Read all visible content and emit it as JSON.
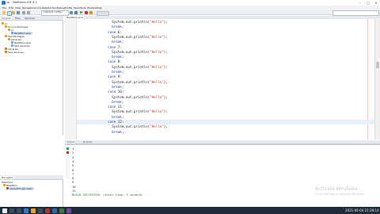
{
  "window": {
    "title": "pr - NetBeans IDE 8.2",
    "controls": [
      "–",
      "□",
      "✕"
    ]
  },
  "menubar": {
    "items": [
      "File",
      "Edit",
      "View",
      "Navigate",
      "Source",
      "Refactor",
      "Run",
      "Debug",
      "Profile",
      "Team",
      "Tools",
      "Window",
      "Help"
    ]
  },
  "toolbar": {
    "config_select": "<default config>"
  },
  "projects_panel": {
    "tabs": [
      "Projects",
      "Files",
      "Services"
    ],
    "tree": [
      {
        "label": "pr",
        "level": 0
      },
      {
        "label": "Source Packages",
        "level": 1
      },
      {
        "label": "pr",
        "level": 2
      },
      {
        "label": "NewMain.java",
        "level": 3
      },
      {
        "label": "Test Packages",
        "level": 1
      },
      {
        "label": "Libraries",
        "level": 1
      },
      {
        "label": "NewMain.java",
        "level": 3
      },
      {
        "label": "Test Libraries",
        "level": 1
      },
      {
        "label": "Libraries",
        "level": 0
      },
      {
        "label": "Test Libraries",
        "level": 0
      }
    ]
  },
  "navigator_panel": {
    "tabs": [
      "Navigator"
    ],
    "items": [
      "Members",
      "NewMain",
      "main(String[] args)"
    ]
  },
  "editor": {
    "tab_label": "NewMain.java",
    "toolbar_buttons": [
      "Source",
      "History"
    ],
    "code_lines": [
      {
        "indent": 10,
        "parts": [
          {
            "t": "System.out.println("
          },
          {
            "t": "\"Hello\"",
            "c": "str"
          },
          {
            "t": ");"
          }
        ]
      },
      {
        "indent": 10,
        "parts": [
          {
            "t": "break",
            "c": "kw"
          },
          {
            "t": ";"
          }
        ]
      },
      {
        "indent": 8,
        "parts": [
          {
            "t": "case",
            "c": "kw"
          },
          {
            "t": " 6:"
          }
        ]
      },
      {
        "indent": 10,
        "parts": [
          {
            "t": "System.out.println("
          },
          {
            "t": "\"Hello\"",
            "c": "str"
          },
          {
            "t": ");"
          }
        ]
      },
      {
        "indent": 10,
        "parts": [
          {
            "t": "break",
            "c": "kw"
          },
          {
            "t": ";"
          }
        ]
      },
      {
        "indent": 8,
        "parts": [
          {
            "t": "case",
            "c": "kw"
          },
          {
            "t": " 7:"
          }
        ]
      },
      {
        "indent": 10,
        "parts": [
          {
            "t": "System.out.println("
          },
          {
            "t": "\"Hello\"",
            "c": "str"
          },
          {
            "t": ");"
          }
        ]
      },
      {
        "indent": 10,
        "parts": [
          {
            "t": "break",
            "c": "kw"
          },
          {
            "t": ";"
          }
        ]
      },
      {
        "indent": 8,
        "parts": [
          {
            "t": "case",
            "c": "kw"
          },
          {
            "t": " 8:"
          }
        ]
      },
      {
        "indent": 10,
        "parts": [
          {
            "t": "System.out.println("
          },
          {
            "t": "\"Hello\"",
            "c": "str"
          },
          {
            "t": ");"
          }
        ]
      },
      {
        "indent": 10,
        "parts": [
          {
            "t": "break",
            "c": "kw"
          },
          {
            "t": ";"
          }
        ]
      },
      {
        "indent": 8,
        "parts": [
          {
            "t": "case",
            "c": "kw"
          },
          {
            "t": " 9:"
          }
        ]
      },
      {
        "indent": 10,
        "parts": [
          {
            "t": "System.out.println("
          },
          {
            "t": "\"Hello\"",
            "c": "str"
          },
          {
            "t": ");"
          }
        ]
      },
      {
        "indent": 10,
        "parts": [
          {
            "t": "break",
            "c": "kw"
          },
          {
            "t": ";"
          }
        ]
      },
      {
        "indent": 8,
        "parts": [
          {
            "t": "case",
            "c": "kw"
          },
          {
            "t": " 10:"
          }
        ]
      },
      {
        "indent": 10,
        "parts": [
          {
            "t": "System.out.println("
          },
          {
            "t": "\"Hello\"",
            "c": "str"
          },
          {
            "t": ");"
          }
        ]
      },
      {
        "indent": 10,
        "parts": [
          {
            "t": "break",
            "c": "kw"
          },
          {
            "t": ";"
          }
        ]
      },
      {
        "indent": 8,
        "parts": [
          {
            "t": "case",
            "c": "kw"
          },
          {
            "t": " 11:"
          }
        ]
      },
      {
        "indent": 10,
        "parts": [
          {
            "t": "System.out.println("
          },
          {
            "t": "\"Hello\"",
            "c": "str"
          },
          {
            "t": ");"
          }
        ]
      },
      {
        "indent": 10,
        "parts": [
          {
            "t": "break",
            "c": "kw"
          },
          {
            "t": ";"
          }
        ]
      },
      {
        "indent": 8,
        "parts": [
          {
            "t": "case",
            "c": "kw"
          },
          {
            "t": " 12:"
          }
        ]
      },
      {
        "indent": 10,
        "parts": [
          {
            "t": "System.out.println("
          },
          {
            "t": "\"Hello\"",
            "c": "str"
          },
          {
            "t": ");"
          }
        ]
      },
      {
        "indent": 10,
        "parts": [
          {
            "t": "break",
            "c": "kw"
          },
          {
            "t": ";"
          }
        ]
      }
    ],
    "highlighted_line_index": 20
  },
  "output": {
    "tabs": [
      "Output",
      "pr (run)"
    ],
    "lines": [
      "1",
      "2",
      "3",
      "4",
      "5",
      "6",
      "7",
      "8",
      "9",
      "10",
      "11",
      "BUILD SUCCESSFUL (total time: 1 second)"
    ]
  },
  "watermark": {
    "line1": "Activate Windows",
    "line2": "Go to Settings to activate Windows."
  },
  "taskbar": {
    "clock": "2021-06-04 21:28:14"
  }
}
